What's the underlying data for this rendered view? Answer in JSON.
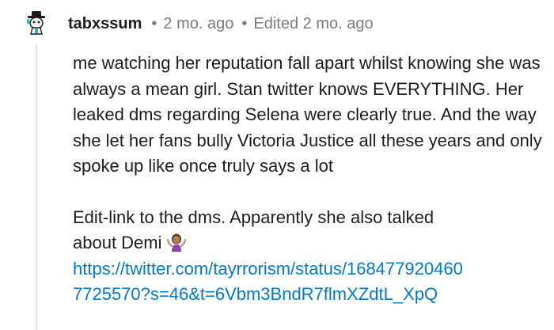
{
  "comment": {
    "author": "tabxssum",
    "posted": "2 mo. ago",
    "edited": "Edited 2 mo. ago",
    "separator": "•",
    "paragraph1": "me watching her reputation fall apart whilst knowing she was always a mean girl. Stan twitter knows EVERYTHING. Her leaked dms regarding Selena were clearly true. And the way she let her fans bully Victoria Justice all these years and only spoke up like once truly says a lot",
    "paragraph2_line1": "Edit-link to the dms. Apparently she also talked",
    "paragraph2_line2": "about Demi",
    "emoji": "person-shrugging-emoji",
    "link_line1": "https://twitter.com/tayrrorism/status/168477920460",
    "link_line2": "7725570?s=46&t=6Vbm3BndR7flmXZdtL_XpQ",
    "link_color": "#0079d3"
  }
}
